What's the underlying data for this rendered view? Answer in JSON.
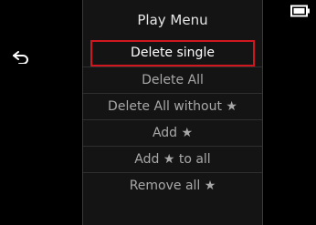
{
  "menu": {
    "title": "Play Menu",
    "items": [
      {
        "label": "Delete single",
        "selected": true
      },
      {
        "label": "Delete All",
        "selected": false
      },
      {
        "label": "Delete All without ★",
        "selected": false
      },
      {
        "label": "Add ★",
        "selected": false
      },
      {
        "label": "Add ★ to all",
        "selected": false
      },
      {
        "label": "Remove all ★",
        "selected": false
      }
    ]
  },
  "icons": {
    "back": "back-arrow-icon",
    "battery": "battery-icon"
  },
  "colors": {
    "highlight": "#d0171f",
    "panel_bg": "#141414",
    "text_selected": "#ffffff",
    "text_normal": "#a8a8a8"
  }
}
